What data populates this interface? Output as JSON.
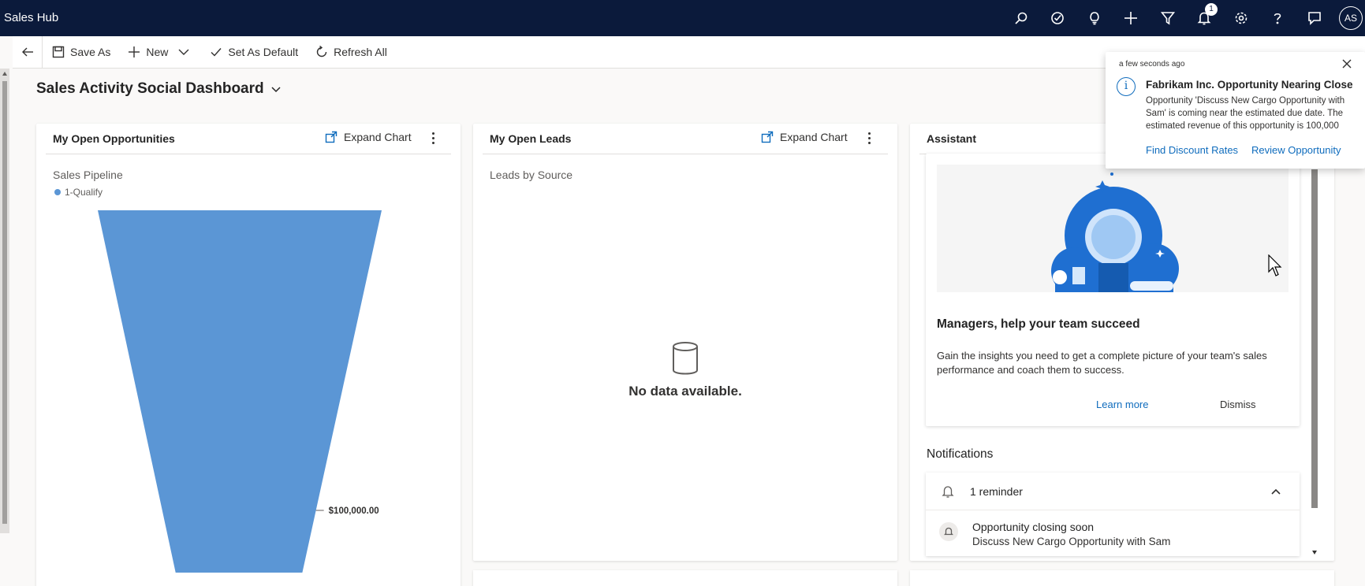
{
  "app": {
    "title": "Sales Hub",
    "user_initials": "AS"
  },
  "topbar": {
    "icons": [
      "search-icon",
      "target-icon",
      "lightbulb-icon",
      "plus-icon",
      "filter-icon",
      "bell-icon",
      "gear-icon",
      "help-icon",
      "chat-icon"
    ],
    "notification_count": "1"
  },
  "commandbar": {
    "save_as": "Save As",
    "new": "New",
    "set_as_default": "Set As Default",
    "refresh_all": "Refresh All"
  },
  "dashboard": {
    "title": "Sales Activity Social Dashboard"
  },
  "cards": {
    "opportunities": {
      "title": "My Open Opportunities",
      "expand": "Expand Chart",
      "chart_title": "Sales Pipeline",
      "legend": "1-Qualify",
      "data_label": "$100,000.00"
    },
    "leads": {
      "title": "My Open Leads",
      "expand": "Expand Chart",
      "chart_title": "Leads by Source",
      "no_data": "No data available."
    },
    "assistant": {
      "title": "Assistant",
      "heading": "Managers, help your team succeed",
      "body": "Gain the insights you need to get a complete picture of your team's sales performance and coach them to success.",
      "learn_more": "Learn more",
      "dismiss": "Dismiss"
    }
  },
  "notifications": {
    "title": "Notifications",
    "group_label": "1 reminder",
    "item_title": "Opportunity closing soon",
    "item_body": "Discuss New Cargo Opportunity with Sam"
  },
  "toast": {
    "time": "a few seconds ago",
    "title": "Fabrikam Inc. Opportunity Nearing Close",
    "body": "Opportunity 'Discuss New Cargo Opportunity with Sam' is coming near the estimated due date. The estimated revenue of this opportunity is 100,000",
    "action1": "Find Discount Rates",
    "action2": "Review Opportunity"
  },
  "chart_data": {
    "type": "funnel",
    "title": "Sales Pipeline",
    "categories": [
      "1-Qualify"
    ],
    "values": [
      100000
    ],
    "colors": [
      "#5b96d5"
    ]
  },
  "colors": {
    "topbar": "#0b1a3b",
    "accent": "#0f6cbd",
    "funnel": "#5b96d5"
  }
}
